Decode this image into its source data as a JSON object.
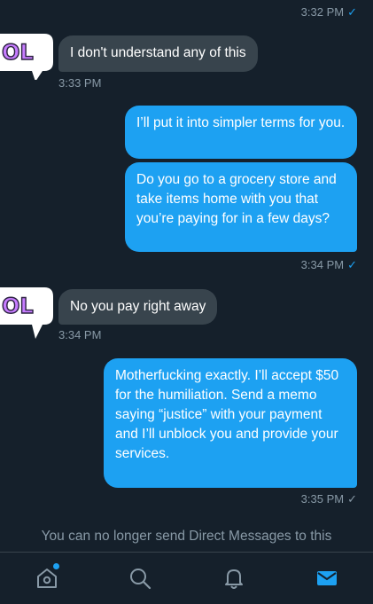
{
  "colors": {
    "background": "#15202b",
    "outgoing_bubble": "#1da1f2",
    "incoming_bubble": "#38444d",
    "muted_text": "#8899a6",
    "accent": "#1da1f2"
  },
  "messages": [
    {
      "timestamp": "3:32 PM",
      "read_check": "✓"
    },
    {
      "text": "I don't understand any of this",
      "timestamp": "3:33 PM"
    },
    {
      "text": "I’ll put it into simpler terms for you."
    },
    {
      "text": "Do you go to a grocery store and take items home with you that you’re paying for in a few days?",
      "timestamp": "3:34 PM",
      "read_check": "✓"
    },
    {
      "text": "No you pay right away",
      "timestamp": "3:34 PM"
    },
    {
      "text": "Motherfucking exactly.    I’ll accept $50 for the humiliation. Send a memo saying “justice” with your payment and I’ll unblock you and provide your services.",
      "timestamp": "3:35 PM",
      "read_check": "✓"
    }
  ],
  "avatar": {
    "text": "OL",
    "icon": "lol-speech-bubble-avatar"
  },
  "notice": "You can no longer send Direct Messages to this",
  "tabs": [
    {
      "icon": "home-icon",
      "has_notification_dot": true
    },
    {
      "icon": "search-icon"
    },
    {
      "icon": "bell-icon"
    },
    {
      "icon": "mail-icon",
      "active": true
    }
  ]
}
